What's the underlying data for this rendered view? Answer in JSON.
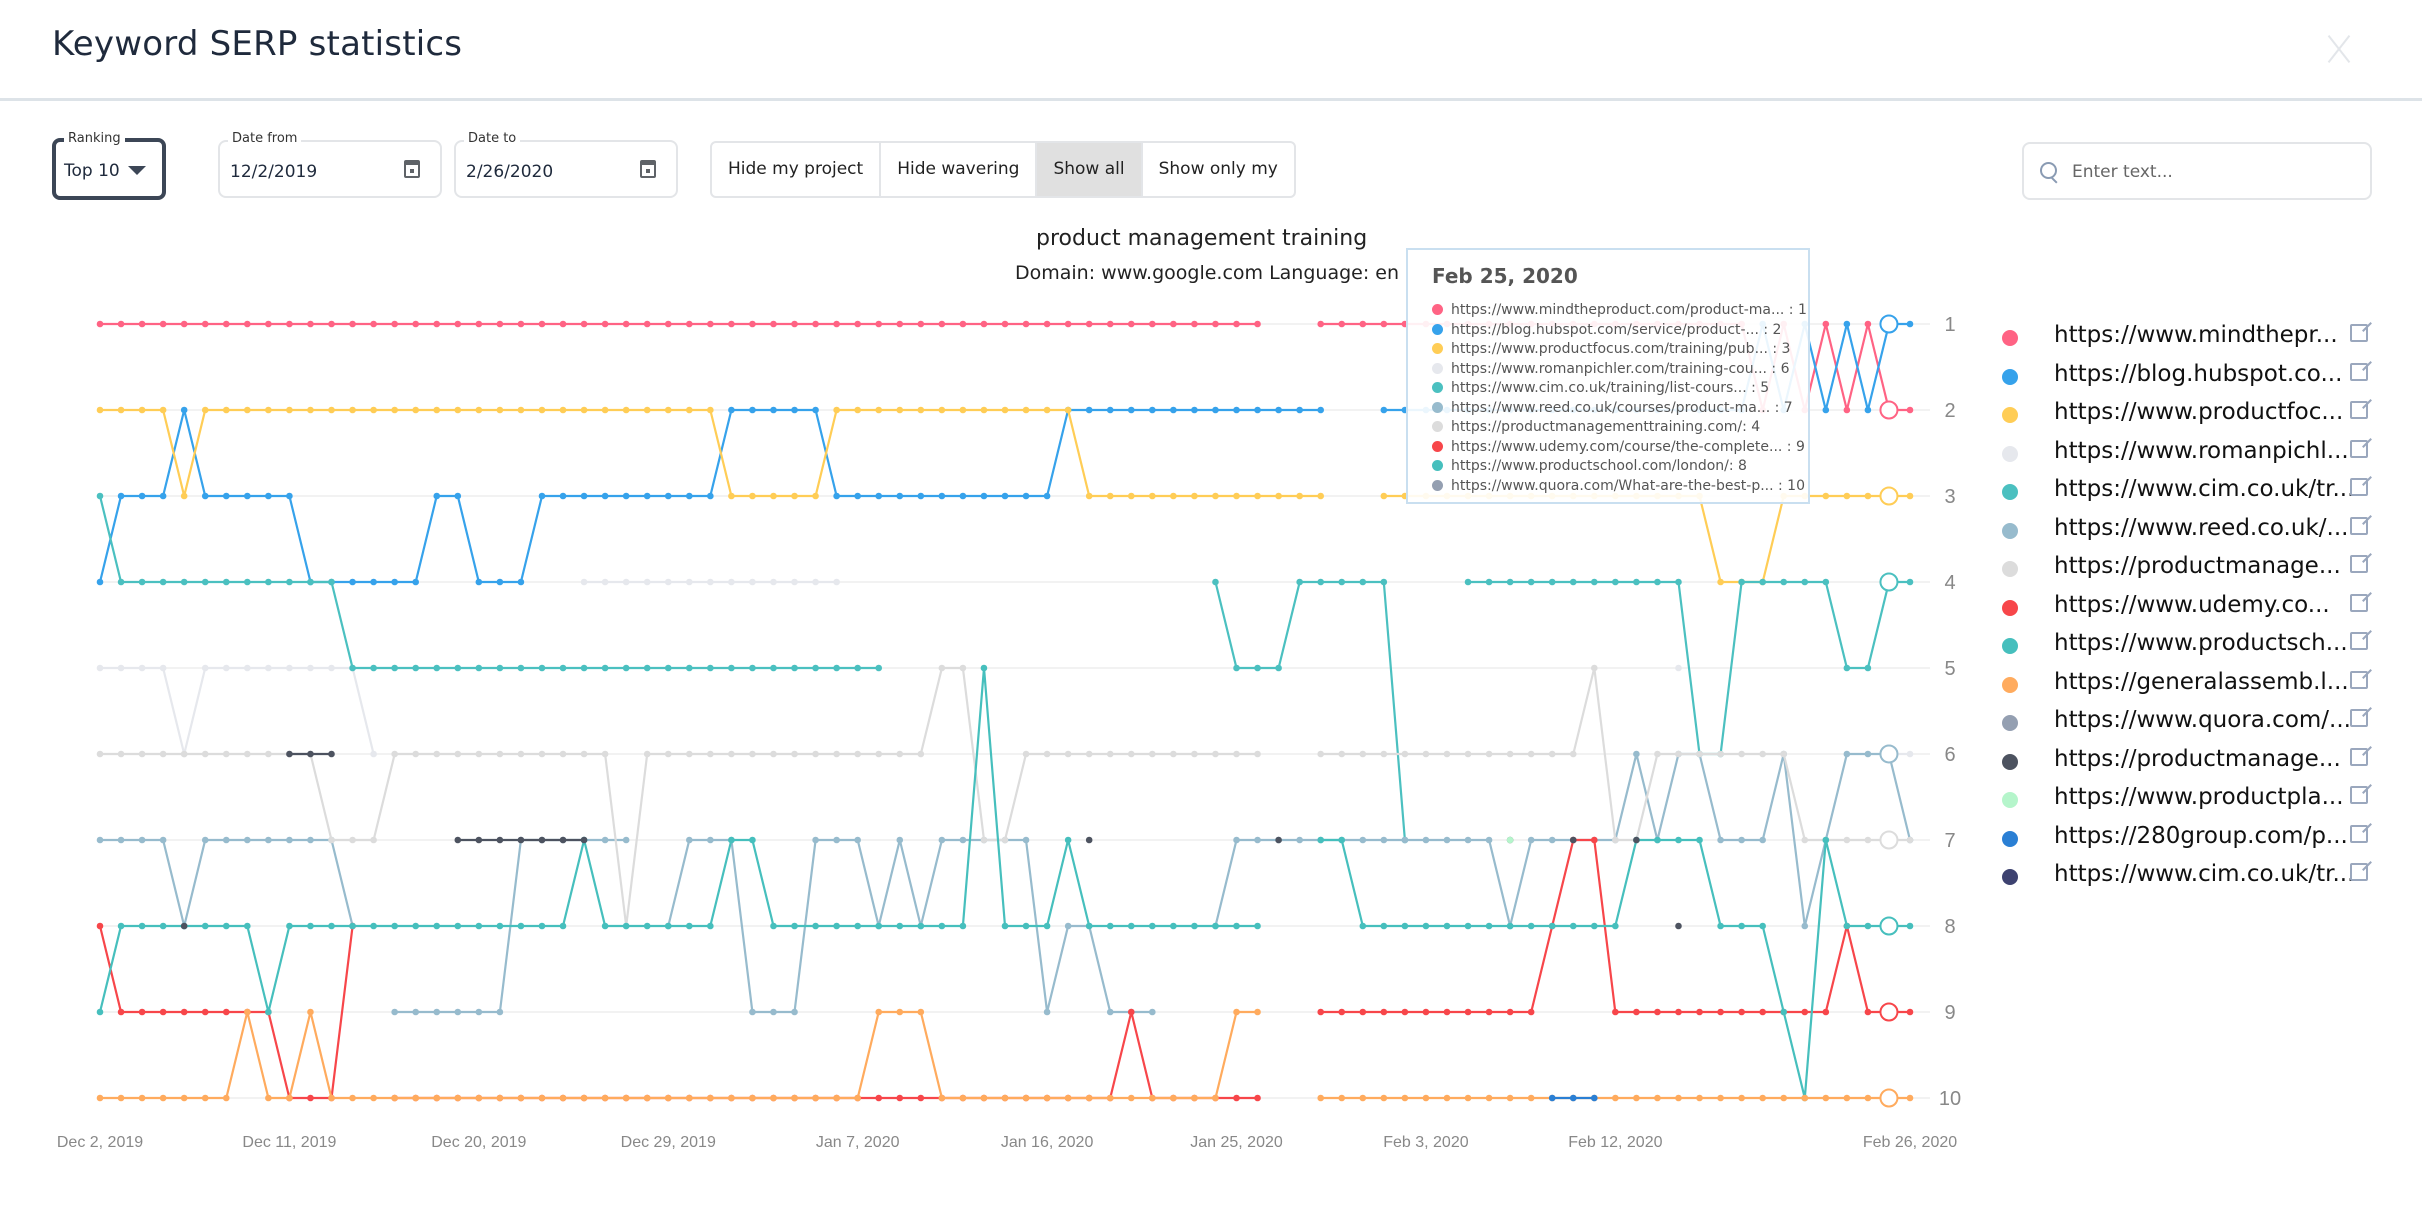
{
  "dialog": {
    "title": "Keyword SERP statistics",
    "close_icon": "close-icon"
  },
  "filters": {
    "ranking": {
      "label": "Ranking",
      "value": "Top 10"
    },
    "date_from": {
      "label": "Date from",
      "value": "12/2/2019"
    },
    "date_to": {
      "label": "Date to",
      "value": "2/26/2020"
    },
    "view_buttons": [
      {
        "label": "Hide my project",
        "active": false
      },
      {
        "label": "Hide wavering",
        "active": false
      },
      {
        "label": "Show all",
        "active": true
      },
      {
        "label": "Show only my",
        "active": false
      }
    ],
    "search": {
      "placeholder": "Enter text...",
      "value": ""
    }
  },
  "tooltip": {
    "date": "Feb 25, 2020",
    "rows": [
      {
        "color": "#ff6384",
        "text": "https://www.mindtheproduct.com/product-ma... : 1"
      },
      {
        "color": "#36a2eb",
        "text": "https://blog.hubspot.com/service/product-... : 2"
      },
      {
        "color": "#ffcd56",
        "text": "https://www.productfocus.com/training/pub... : 3"
      },
      {
        "color": "#e6e8ed",
        "text": "https://www.romanpichler.com/training-cou... : 6"
      },
      {
        "color": "#4bc0c0",
        "text": "https://www.cim.co.uk/training/list-cours... : 5"
      },
      {
        "color": "#97bbcd",
        "text": "https://www.reed.co.uk/courses/product-ma... : 7"
      },
      {
        "color": "#dcdcdc",
        "text": "https://productmanagementtraining.com/: 4"
      },
      {
        "color": "#f7464a",
        "text": "https://www.udemy.com/course/the-complete... : 9"
      },
      {
        "color": "#46bfbd",
        "text": "https://www.productschool.com/london/: 8"
      },
      {
        "color": "#949fb1",
        "text": "https://www.quora.com/What-are-the-best-p... : 10"
      }
    ]
  },
  "chart_data": {
    "type": "line",
    "title": "product management training",
    "subtitle": "Domain: www.google.com Language: en",
    "x_start": "2019-12-02",
    "x_end": "2020-02-26",
    "x_ticks": [
      "Dec 2, 2019",
      "Dec 11, 2019",
      "Dec 20, 2019",
      "Dec 29, 2019",
      "Jan 7, 2020",
      "Jan 16, 2020",
      "Jan 25, 2020",
      "Feb 3, 2020",
      "Feb 12, 2020",
      "Feb 26, 2020"
    ],
    "x_tick_days": [
      0,
      9,
      18,
      27,
      36,
      45,
      54,
      63,
      72,
      86
    ],
    "y_ticks": [
      1,
      2,
      3,
      4,
      5,
      6,
      7,
      8,
      9,
      10
    ],
    "ylim": [
      1,
      10
    ],
    "y_reversed": true,
    "y_axis_position": "right",
    "grid": false,
    "legend_position": "right",
    "highlight_day": 85,
    "series_encoding": "one character per day starting Dec 2, 2019; 1-9 = rank, 0 = rank 10, '-' = not in top 10",
    "series": [
      {
        "name": "https://www.mindtheproduct.com/product-ma...",
        "legend": "https://www.mindthepr...",
        "color": "#ff6384",
        "ranks": "11111111111111111111111111111111111111111111111111111111--11111111111111111111121212122111111"
      },
      {
        "name": "https://blog.hubspot.com/service/product-...",
        "legend": "https://blog.hubspot.co...",
        "color": "#36a2eb",
        "ranks": "43332333334444443344433333333322222333333333332222222222222--22222222222222222212121211222222"
      },
      {
        "name": "https://www.productfocus.com/training/pub...",
        "legend": "https://www.productfoc...",
        "color": "#ffcd56",
        "ranks": "22223222222222222222222222222233333222222222222333333333333--3333333333333333444333333333333"
      },
      {
        "name": "https://www.romanpichler.com/training-cou...",
        "legend": "https://www.romanpichl...",
        "color": "#e6e8ed",
        "ranks": "55556555555556---------4444444444444---------------------------------------5---------665--"
      },
      {
        "name": "https://www.cim.co.uk/training/list-cours...",
        "legend": "https://www.cim.co.uk/tr...",
        "color": "#4bc0c0",
        "ranks": "34444444444455555555555555555555555555---------------4555444447--444444444446644444554455"
      },
      {
        "name": "https://www.reed.co.uk/courses/product-ma...",
        "legend": "https://www.reed.co.uk/...",
        "color": "#97bbcd",
        "ranks": "7777877777778-999999777777-877799977787877777988999--8777777777777787777767667776876667676"
      },
      {
        "name": "https://productmanagementtraining.com/",
        "legend": "https://productmanage...",
        "color": "#dcdcdc",
        "ranks": "66666666666777666666666668666666666666665577666666666666--666666666666657766666667777777474"
      },
      {
        "name": "https://www.udemy.com/course/the-complete...",
        "legend": "https://www.udemy.co...",
        "color": "#f7464a",
        "ranks": "8999999990008-000000000000000000000000000000000009000000--999999999998779999999999989999998"
      },
      {
        "name": "https://www.productschool.com/london/",
        "legend": "https://www.productsch...",
        "color": "#46bfbd",
        "ranks": "98888888988888888888888788888877888888888858887888888888--7788888888888887777888907888889"
      },
      {
        "name": "https://generalassemb.ly/...",
        "legend": "https://generalassemb.l...",
        "color": "#ffab5e",
        "ranks": "00000009009000000000000000000000000009990000000000000099--0000000000000000000000000000000"
      },
      {
        "name": "https://www.quora.com/...",
        "legend": "https://www.quora.com/...",
        "color": "#949fb1",
        "ranks": "-------------------------------------------------------------------------------------------0-"
      },
      {
        "name": "https://productmanage...",
        "legend": "https://productmanage...",
        "color": "#4d5360",
        "ranks": "----8----666-----7777777-----------------------7--------7----------7--7--7-8----------"
      },
      {
        "name": "https://www.productpla...",
        "legend": "https://www.productpla...",
        "color": "#b5f5cb",
        "ranks": "-------------------------------------------------------------------7-------------------"
      },
      {
        "name": "https://280group.com/p...",
        "legend": "https://280group.com/p...",
        "color": "#2a7fd4",
        "ranks": "---------------------------------------------------------------------000----------------"
      },
      {
        "name": "https://www.cim.co.uk/tr...",
        "legend": "https://www.cim.co.uk/tr...",
        "color": "#3d4270",
        "ranks": "-----------------------------------------------------------------------------------------"
      }
    ]
  }
}
